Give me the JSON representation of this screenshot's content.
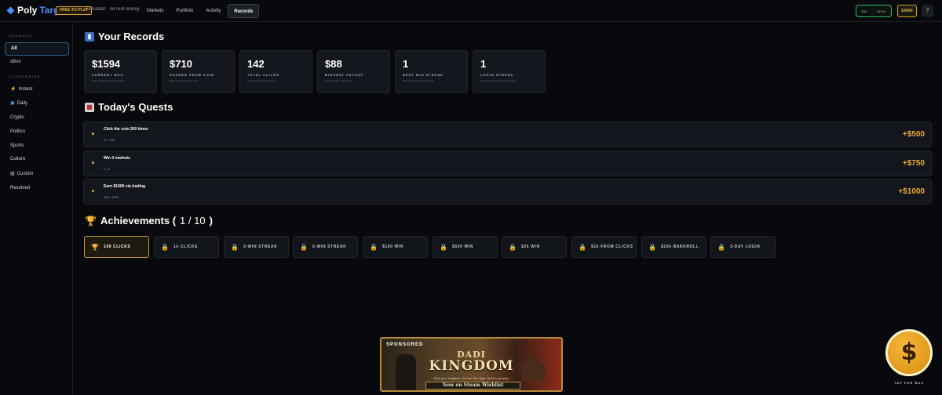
{
  "header": {
    "logo_poly": "Poly",
    "logo_target": "Target",
    "badge": "FREE-TO-PLAY",
    "sim_text": "simulator · no real money",
    "nav": [
      {
        "label": "Markets"
      },
      {
        "label": "Portfolio"
      },
      {
        "label": "Activity"
      },
      {
        "label": "Records"
      }
    ],
    "balance_a": "$88",
    "balance_b": "$1594",
    "earn_label": "EARN",
    "help_label": "?"
  },
  "sidebar": {
    "sources_heading": "SOURCES",
    "sources": [
      {
        "label": "All"
      },
      {
        "label": "sBox"
      }
    ],
    "categories_heading": "CATEGORIES",
    "categories": [
      {
        "label": "Instant"
      },
      {
        "label": "Daily"
      },
      {
        "label": "Crypto"
      },
      {
        "label": "Politics"
      },
      {
        "label": "Sports"
      },
      {
        "label": "Culture"
      },
      {
        "label": "Custom"
      },
      {
        "label": "Resolved"
      }
    ]
  },
  "records": {
    "title": "Your Records",
    "stats": [
      {
        "value": "$1594",
        "label": "CURRENT BUX",
        "sub": "Your available spending credits"
      },
      {
        "value": "$710",
        "label": "EARNED FROM COIN",
        "sub": "Earned by tapping the coin"
      },
      {
        "value": "142",
        "label": "TOTAL CLICKS",
        "sub": "Times you tapped the coin"
      },
      {
        "value": "$88",
        "label": "BIGGEST PAYOUT",
        "sub": "Largest single market win"
      },
      {
        "value": "1",
        "label": "BEST WIN STREAK",
        "sub": "Most consecutive market wins"
      },
      {
        "value": "1",
        "label": "LOGIN STREAK",
        "sub": "Consecutive days you came back"
      }
    ]
  },
  "quests": {
    "title": "Today's Quests",
    "items": [
      {
        "title": "Click the coin 200 times",
        "progress": "97 / 200",
        "reward": "+$500"
      },
      {
        "title": "Win 3 markets",
        "progress": "2 / 3",
        "reward": "+$750"
      },
      {
        "title": "Earn $1000 via trading",
        "progress": "155 / 1000",
        "reward": "+$1000"
      }
    ]
  },
  "achievements": {
    "title_prefix": "Achievements (",
    "count": "1 / 10",
    "title_suffix": ")",
    "items": [
      {
        "label": "100 CLICKS",
        "unlocked": true
      },
      {
        "label": "1k CLICKS",
        "unlocked": false
      },
      {
        "label": "3-WIN STREAK",
        "unlocked": false
      },
      {
        "label": "5-WIN STREAK",
        "unlocked": false
      },
      {
        "label": "$100 WIN",
        "unlocked": false
      },
      {
        "label": "$500 WIN",
        "unlocked": false
      },
      {
        "label": "$2k WIN",
        "unlocked": false
      },
      {
        "label": "$1k FROM CLICKS",
        "unlocked": false
      },
      {
        "label": "$10k BANKROLL",
        "unlocked": false
      },
      {
        "label": "3-DAY LOGIN",
        "unlocked": false
      }
    ]
  },
  "ad": {
    "sponsored": "SPONSORED",
    "title_line1": "DADI",
    "title_line2": "KINGDOM",
    "tagline": "Rule your kingdom. Survive the night. Build a dynasty.",
    "cta": "Now on Steam Wishlist"
  },
  "coin": {
    "symbol": "$",
    "label": "TAP FOR BUX"
  },
  "colors": {
    "accent_gold": "#e8aa35",
    "accent_blue": "#4f8cff",
    "balance_border": "#2fbf6a"
  },
  "icons": {
    "records": "bar-chart-icon",
    "quests": "calendar-icon",
    "achievements": "trophy-icon",
    "locked": "lock-icon"
  }
}
